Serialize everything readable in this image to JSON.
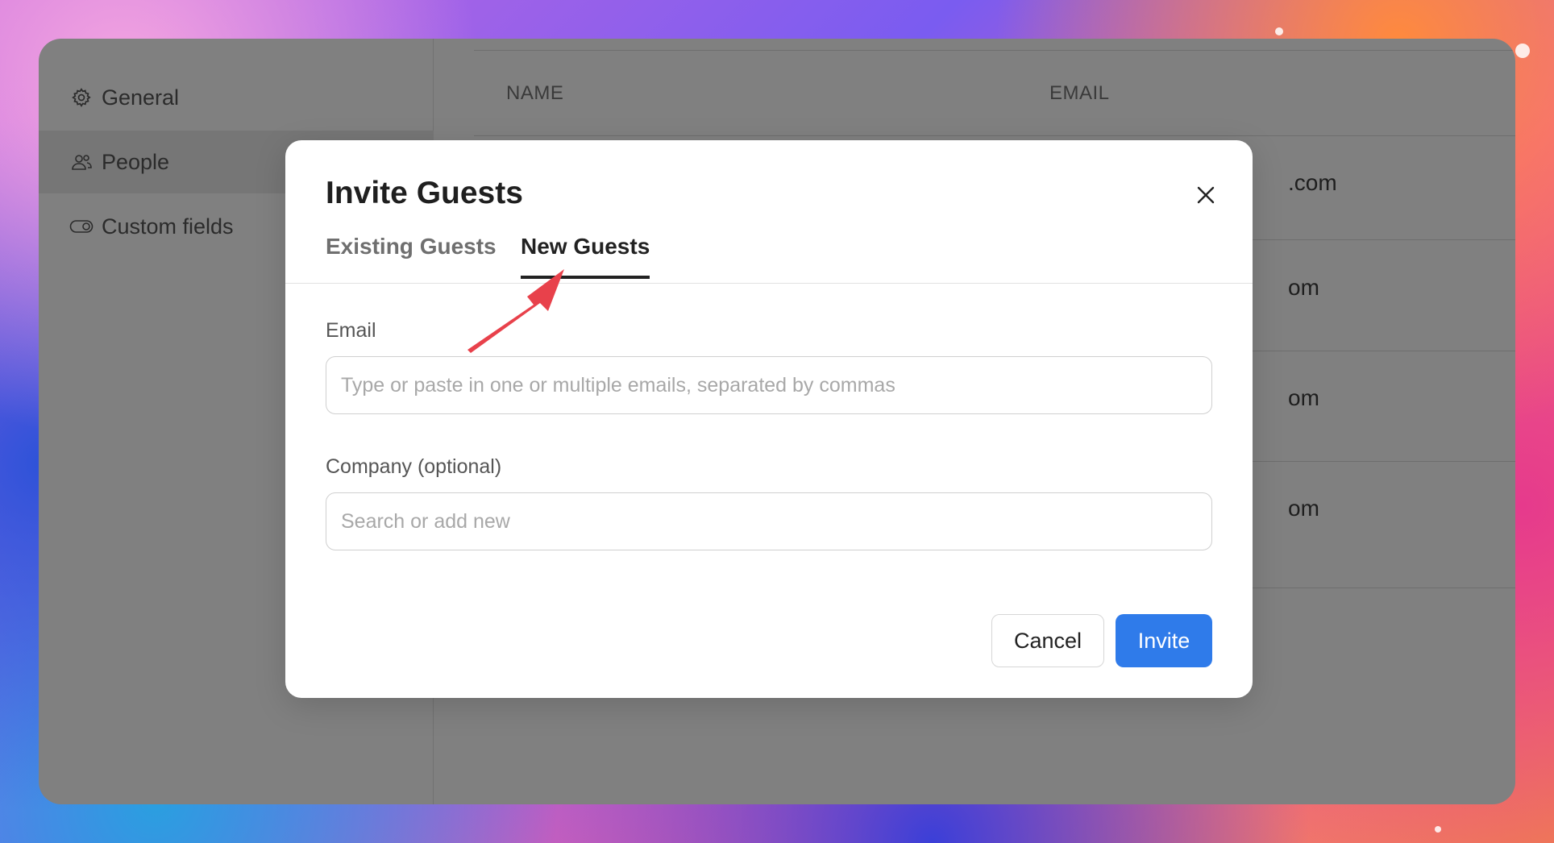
{
  "sidebar": {
    "items": [
      {
        "label": "General",
        "icon": "gear-icon"
      },
      {
        "label": "People",
        "icon": "people-icon"
      },
      {
        "label": "Custom fields",
        "icon": "toggle-icon"
      }
    ]
  },
  "table": {
    "headers": [
      "NAME",
      "EMAIL"
    ],
    "email_fragments": [
      ".com",
      "om",
      "om",
      "om"
    ]
  },
  "modal": {
    "title": "Invite Guests",
    "tabs": [
      {
        "label": "Existing Guests",
        "active": false
      },
      {
        "label": "New Guests",
        "active": true
      }
    ],
    "email": {
      "label": "Email",
      "placeholder": "Type or paste in one or multiple emails, separated by commas",
      "value": ""
    },
    "company": {
      "label": "Company (optional)",
      "placeholder": "Search or add new",
      "value": ""
    },
    "cancel_label": "Cancel",
    "invite_label": "Invite"
  },
  "colors": {
    "primary": "#2f7bea",
    "annotation_arrow": "#e8414b",
    "overlay": "#808080"
  }
}
